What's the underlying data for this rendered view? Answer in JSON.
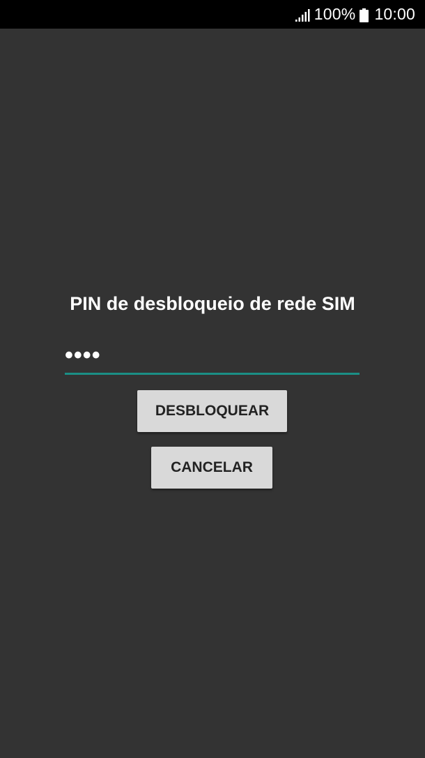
{
  "status_bar": {
    "signal_icon": "signal-bars-icon",
    "battery_percent": "100%",
    "battery_icon": "battery-full-icon",
    "time": "10:00"
  },
  "dialog": {
    "title": "PIN de desbloqueio de rede SIM",
    "pin_value": "••••",
    "accent_color": "#1b8f85",
    "unlock_label": "DESBLOQUEAR",
    "cancel_label": "CANCELAR"
  }
}
